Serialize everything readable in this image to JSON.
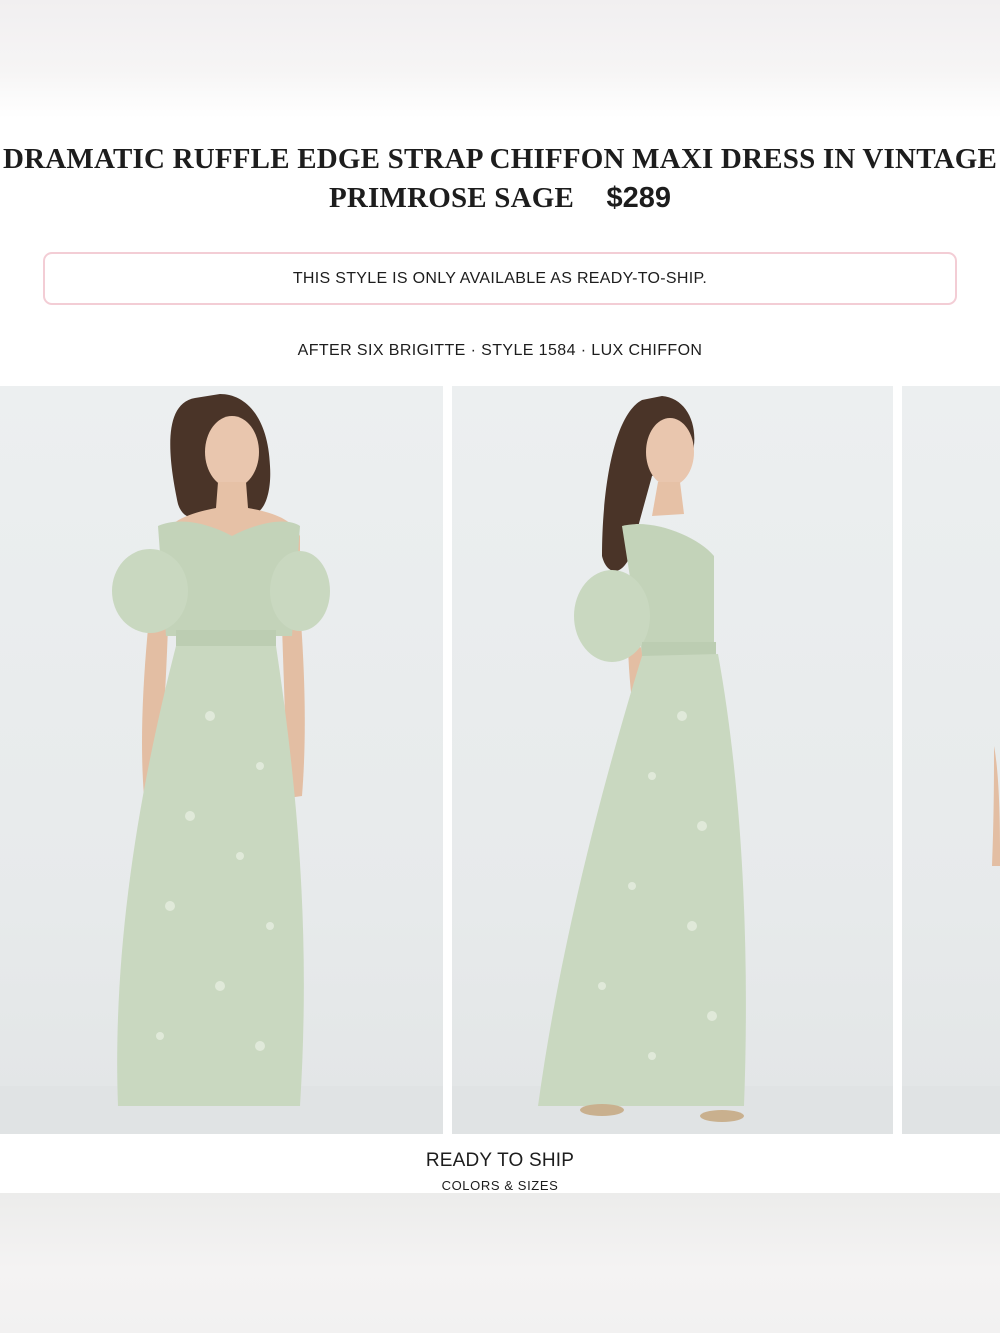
{
  "product": {
    "title": "DRAMATIC RUFFLE EDGE STRAP CHIFFON MAXI DRESS IN VINTAGE PRIMROSE SAGE",
    "price": "$289"
  },
  "notice": {
    "text": "THIS STYLE IS ONLY AVAILABLE AS READY-TO-SHIP.",
    "border_color": "#f3cdd5"
  },
  "meta": {
    "text": "AFTER SIX BRIGITTE · STYLE 1584 · LUX CHIFFON"
  },
  "gallery": {
    "dress_color": "#c9d8c0",
    "images": [
      {
        "view": "front"
      },
      {
        "view": "side"
      },
      {
        "view": "partial"
      }
    ]
  },
  "cta": {
    "title": "READY TO SHIP",
    "subtitle": "COLORS & SIZES"
  }
}
